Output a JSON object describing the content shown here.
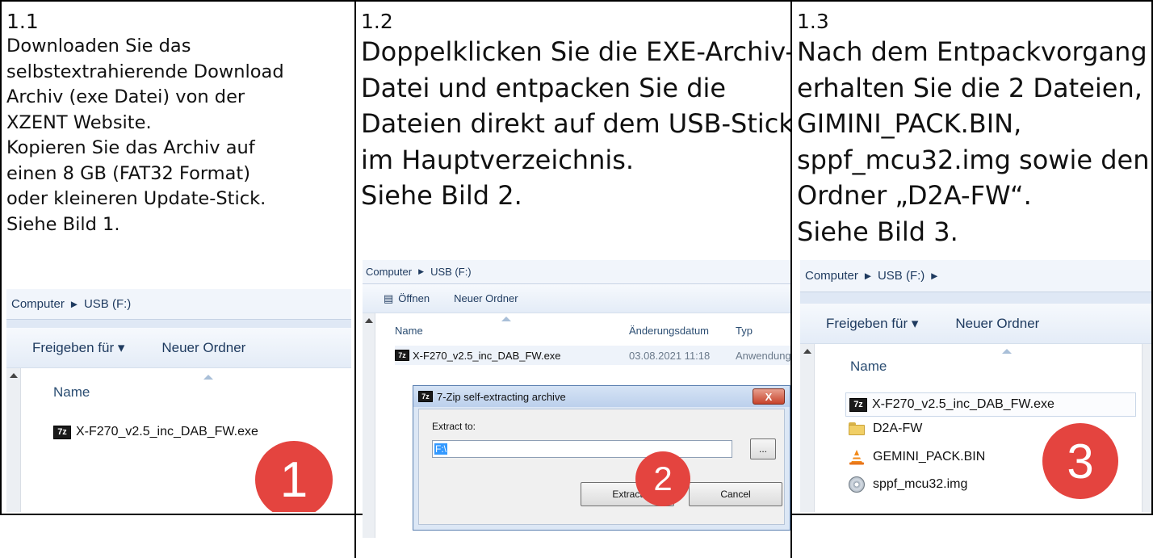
{
  "steps": [
    {
      "number": "1.1",
      "lines": [
        "Downloaden Sie das",
        "selbstextrahierende Download",
        "Archiv (exe Datei) von der",
        "XZENT Website.",
        "Kopieren Sie das Archiv auf",
        "einen 8 GB (FAT32 Format)",
        "oder kleineren Update-Stick.",
        "Siehe Bild 1."
      ],
      "screenshot": {
        "breadcrumb": [
          "Computer",
          "USB (F:)"
        ],
        "toolbar": [
          "Freigeben für ▾",
          "Neuer Ordner"
        ],
        "column_name": "Name",
        "files": [
          {
            "icon": "7zip-icon",
            "name": "X-F270_v2.5_inc_DAB_FW.exe"
          }
        ],
        "badge": "1"
      }
    },
    {
      "number": "1.2",
      "lines": [
        "Doppelklicken Sie die EXE-Archiv-",
        "Datei und entpacken Sie die",
        "Dateien direkt auf dem USB-Stick",
        "im Hauptverzeichnis.",
        "Siehe Bild 2."
      ],
      "screenshot": {
        "breadcrumb": [
          "Computer",
          "USB (F:)"
        ],
        "toolbar": [
          "Öffnen",
          "Neuer Ordner"
        ],
        "columns": [
          "Name",
          "Änderungsdatum",
          "Typ"
        ],
        "file": {
          "name": "X-F270_v2.5_inc_DAB_FW.exe",
          "date": "03.08.2021 11:18",
          "type": "Anwendung"
        },
        "dialog": {
          "title": "7-Zip self-extracting archive",
          "close": "X",
          "extract_label": "Extract to:",
          "path": "F:\\",
          "browse": "...",
          "extract_button": "Extract",
          "cancel_button": "Cancel"
        },
        "badge": "2"
      }
    },
    {
      "number": "1.3",
      "lines": [
        "Nach dem Entpackvorgang",
        "erhalten Sie die 2 Dateien,",
        "GIMINI_PACK.BIN,",
        "sppf_mcu32.img sowie den",
        "Ordner „D2A-FW“.",
        "Siehe Bild 3."
      ],
      "screenshot": {
        "breadcrumb": [
          "Computer",
          "USB (F:)"
        ],
        "toolbar": [
          "Freigeben für ▾",
          "Neuer Ordner"
        ],
        "column_name": "Name",
        "files": [
          {
            "icon": "7zip-icon",
            "name": "X-F270_v2.5_inc_DAB_FW.exe"
          },
          {
            "icon": "folder-icon",
            "name": "D2A-FW"
          },
          {
            "icon": "vlc-cone-icon",
            "name": "GEMINI_PACK.BIN"
          },
          {
            "icon": "disc-image-icon",
            "name": "sppf_mcu32.img"
          }
        ],
        "badge": "3"
      }
    }
  ],
  "icon_glyphs": {
    "zip": "7z",
    "chevron": "▶",
    "open": "▤"
  },
  "colors": {
    "badge": "#e4443f",
    "explorer_header": "#f1f5fb",
    "toolbar_text": "#1e3a5f"
  }
}
